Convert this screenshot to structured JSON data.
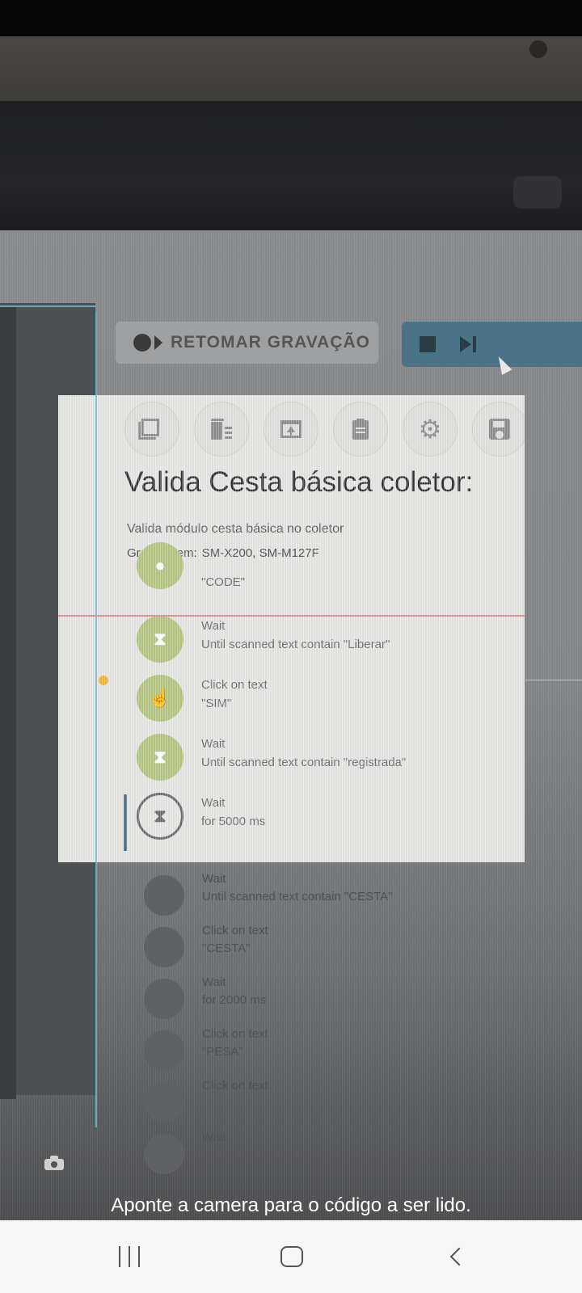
{
  "background_app": {
    "resume_button_label": "RETOMAR GRAVAÇÃO",
    "lower_steps": [
      {
        "line1": "Wait",
        "line2": "Until scanned text contain \"CESTA\""
      },
      {
        "line1": "Click on text",
        "line2": "\"CESTA\""
      },
      {
        "line1": "Wait",
        "line2": "for 2000 ms"
      },
      {
        "line1": "Click on text",
        "line2": "\"PESA\""
      },
      {
        "line1": "Click on text",
        "line2": ""
      },
      {
        "line1": "Wait",
        "line2": ""
      }
    ]
  },
  "scan_window": {
    "toolbar_icons": [
      "copy-icon",
      "delete-icon",
      "upload-icon",
      "clipboard-icon",
      "gear-icon",
      "save-icon"
    ],
    "title": "Valida Cesta básica coletor:",
    "description": "Valida módulo cesta básica no coletor",
    "recorded_label": "Gravado em:",
    "recorded_devices": "SM-X200, SM-M127F",
    "steps": [
      {
        "line1": "",
        "line2": "\"CODE\"",
        "icon": "tap-icon"
      },
      {
        "line1": "Wait",
        "line2": "Until scanned text contain \"Liberar\"",
        "icon": "hourglass-icon"
      },
      {
        "line1": "Click on text",
        "line2": "\"SIM\"",
        "icon": "tap-icon"
      },
      {
        "line1": "Wait",
        "line2": "Until scanned text contain \"registrada\"",
        "icon": "hourglass-icon"
      },
      {
        "line1": "Wait",
        "line2": "for 5000 ms",
        "icon": "hourglass-icon"
      }
    ]
  },
  "prompt_text": "Aponte a camera para o código a ser lido.",
  "nav": {
    "recent": "recent-apps-icon",
    "home": "home-icon",
    "back": "back-icon"
  },
  "colors": {
    "step_icon_green": "#b6c783",
    "control_bar": "#4a7387",
    "scan_line": "#e58a88"
  }
}
